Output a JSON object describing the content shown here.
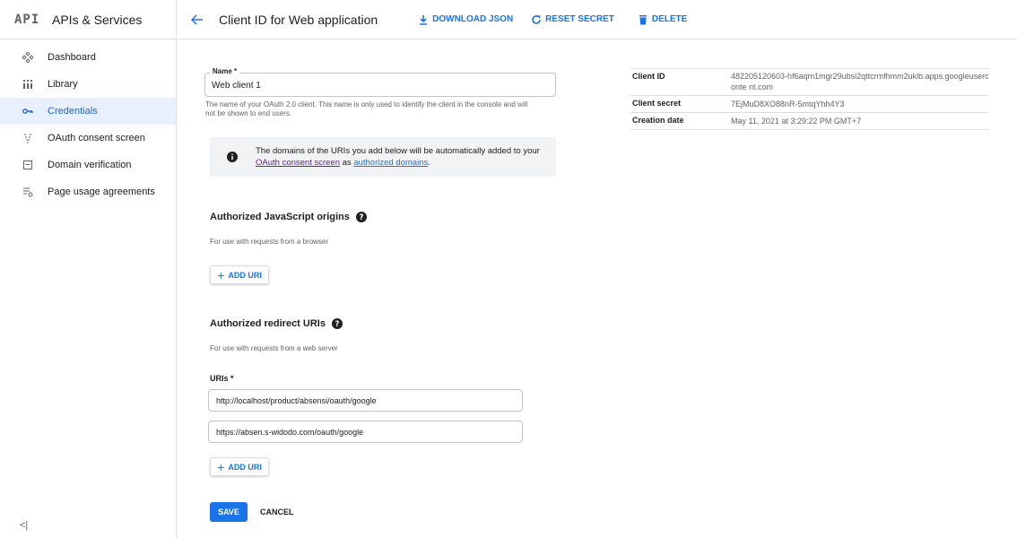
{
  "sidebar": {
    "logo": "API",
    "title": "APIs & Services",
    "items": [
      {
        "label": "Dashboard",
        "icon": "dashboard-icon"
      },
      {
        "label": "Library",
        "icon": "library-icon"
      },
      {
        "label": "Credentials",
        "icon": "key-icon",
        "active": true
      },
      {
        "label": "OAuth consent screen",
        "icon": "consent-icon"
      },
      {
        "label": "Domain verification",
        "icon": "domain-icon"
      },
      {
        "label": "Page usage agreements",
        "icon": "settings-list-icon"
      }
    ],
    "collapse_label": "<|"
  },
  "header": {
    "title": "Client ID for Web application",
    "download_label": "DOWNLOAD JSON",
    "reset_label": "RESET SECRET",
    "delete_label": "DELETE"
  },
  "form": {
    "name_label": "Name *",
    "name_value": "Web client 1",
    "name_help": "The name of your OAuth 2.0 client. This name is only used to identify the client in the console and will not be shown to end users.",
    "info": {
      "prefix": "The domains of the URIs you add below will be automatically added to your ",
      "link1": "OAuth consent screen",
      "middle": " as ",
      "link2": "authorized domains",
      "suffix": "."
    },
    "js_origins": {
      "title": "Authorized JavaScript origins",
      "subtitle": "For use with requests from a browser",
      "add_label": "ADD URI"
    },
    "redirect": {
      "title": "Authorized redirect URIs",
      "subtitle": "For use with requests from a web server",
      "uris_label": "URIs *",
      "uris": [
        "http://localhost/product/absensi/oauth/google",
        "https://absen.s-widodo.com/oauth/google"
      ],
      "add_label": "ADD URI"
    },
    "save_label": "SAVE",
    "cancel_label": "CANCEL"
  },
  "details": [
    {
      "key": "Client ID",
      "value": "482205120603-hf6aqm1mgr29ubsi2qttcrmfhmm2uklb.apps.googleuserconte nt.com"
    },
    {
      "key": "Client secret",
      "value": "7EjMuD8XO88nR-5mtqYhh4Y3"
    },
    {
      "key": "Creation date",
      "value": "May 11, 2021 at 3:29:22 PM GMT+7"
    }
  ],
  "colors": {
    "accent": "#1a73e8",
    "active_bg": "#e8f0fe",
    "info_bg": "#f1f3f4"
  }
}
